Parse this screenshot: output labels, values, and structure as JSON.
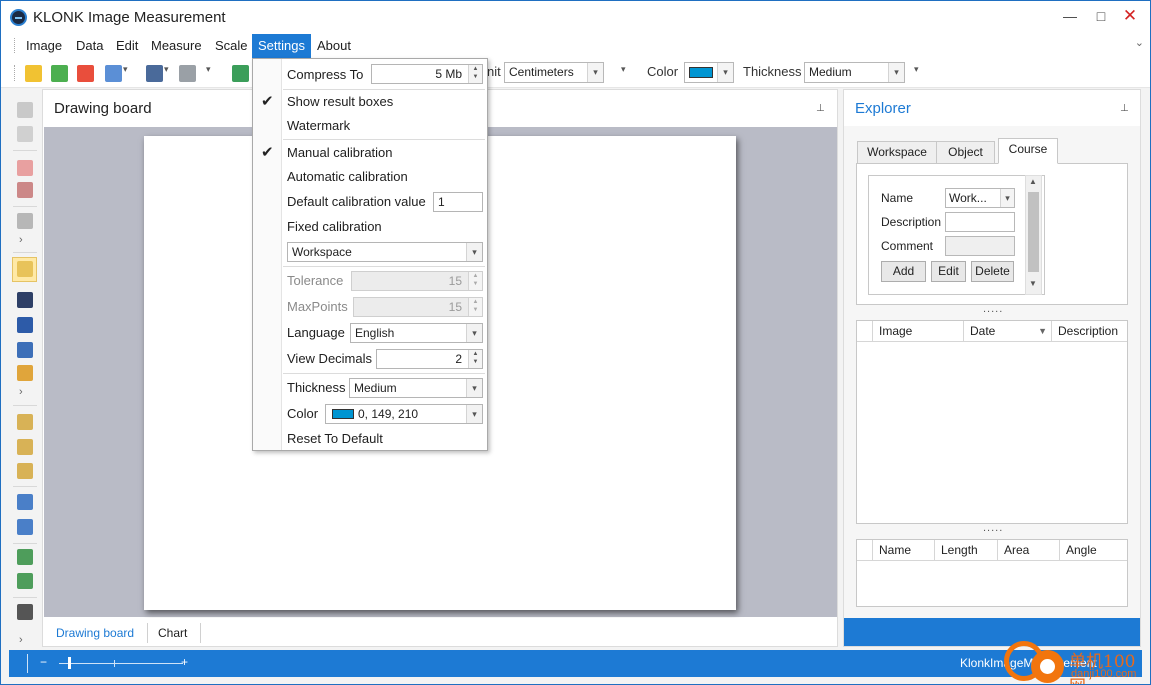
{
  "window": {
    "title": "KLONK Image Measurement",
    "min_glyph": "—",
    "max_glyph": "□",
    "close_glyph": "✕"
  },
  "menu": {
    "items": [
      "Image",
      "Data",
      "Edit",
      "Measure",
      "Scale",
      "Settings",
      "About"
    ],
    "active": "Settings",
    "overflow_glyph": "⌄"
  },
  "toolbar": {
    "unit_label_visible": "nit",
    "unit_value": "Centimeters",
    "color_label": "Color",
    "thickness_label": "Thickness",
    "thickness_value": "Medium",
    "caret": "▾",
    "color_hex": "#0095d2"
  },
  "drawing_board": {
    "title": "Drawing board",
    "pin_glyph": "📌",
    "tabs": [
      "Drawing board",
      "Chart"
    ],
    "selected_tab": "Drawing board"
  },
  "explorer": {
    "title": "Explorer",
    "tabs": [
      "Workspace",
      "Object",
      "Course"
    ],
    "selected_tab": "Course",
    "course": {
      "name_label": "Name",
      "name_value": "Work...",
      "description_label": "Description",
      "comment_label": "Comment",
      "add_button": "Add",
      "edit_button": "Edit",
      "delete_button": "Delete"
    },
    "splitter_dots": ".....",
    "image_grid": {
      "columns": [
        "Image",
        "Date",
        "Description"
      ]
    },
    "measure_grid": {
      "columns": [
        "Name",
        "Length",
        "Area",
        "Angle"
      ]
    }
  },
  "settings_menu": {
    "compress_label": "Compress To",
    "compress_value": "5 Mb",
    "show_result_boxes": "Show result boxes",
    "show_result_boxes_checked": true,
    "watermark": "Watermark",
    "manual_calibration": "Manual calibration",
    "manual_calibration_checked": true,
    "automatic_calibration": "Automatic calibration",
    "default_calibration_label": "Default calibration value",
    "default_calibration_value": "1",
    "fixed_calibration": "Fixed calibration",
    "fixed_calibration_value": "Workspace",
    "tolerance_label": "Tolerance",
    "tolerance_value": "15",
    "maxpoints_label": "MaxPoints",
    "maxpoints_value": "15",
    "language_label": "Language",
    "language_value": "English",
    "view_decimals_label": "View Decimals",
    "view_decimals_value": "2",
    "thickness_label": "Thickness",
    "thickness_value": "Medium",
    "color_label": "Color",
    "color_value": "0, 149, 210",
    "reset": "Reset To Default",
    "check_glyph": "✔"
  },
  "statusbar": {
    "zoom_minus": "−",
    "zoom_plus": "+",
    "app_text": "KlonkImageMeasurement"
  },
  "watermark_logo": {
    "line1": "单机100网",
    "line2": "danji100.com"
  },
  "colors": {
    "accent": "#1d7ad4",
    "measure_color": "#0095d2",
    "canvas_bg": "#b9bbc6"
  }
}
